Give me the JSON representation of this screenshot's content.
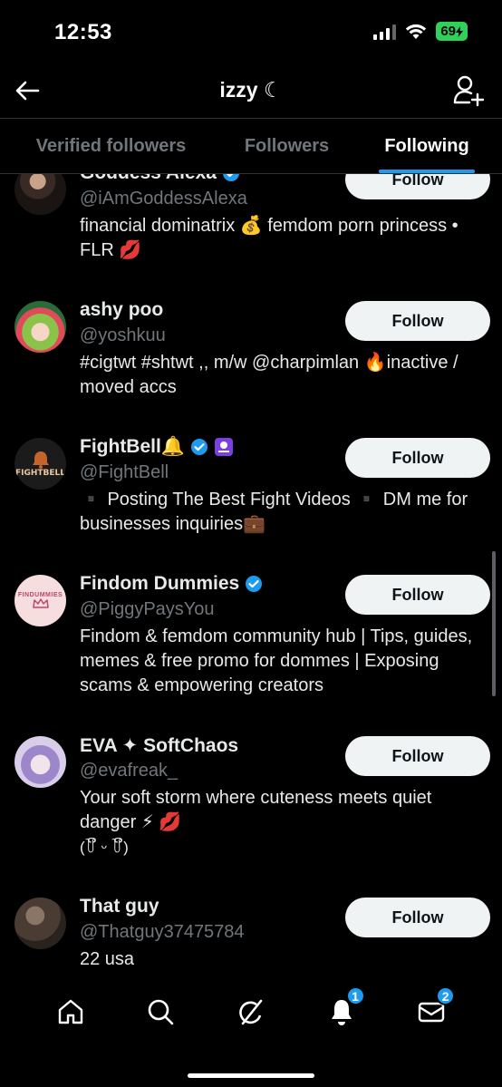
{
  "status": {
    "time": "12:53",
    "battery": "69"
  },
  "header": {
    "title": "izzy ☾"
  },
  "tabs": [
    {
      "label": "Verified followers"
    },
    {
      "label": "Followers"
    },
    {
      "label": "Following"
    }
  ],
  "users": [
    {
      "name": "Goddess Alexa",
      "handle": "@iAmGoddessAlexa",
      "bio": "financial dominatrix 💰 femdom porn princess • FLR 💋",
      "follow_label": "Follow"
    },
    {
      "name": "ashy poo",
      "handle": "@yoshkuu",
      "bio": "#cigtwt #shtwt ,, m/w @charpimlan 🔥inactive / moved accs",
      "follow_label": "Follow"
    },
    {
      "name": "FightBell🔔",
      "handle": "@FightBell",
      "bio": "▪️ Posting The Best Fight Videos ▪️  DM me for businesses inquiries💼",
      "follow_label": "Follow",
      "avatar_text": "FIGHTBELL"
    },
    {
      "name": "Findom Dummies",
      "handle": "@PiggyPaysYou",
      "bio": "Findom & femdom community hub | Tips, guides, memes & free promo for dommes | Exposing scams & empowering creators",
      "follow_label": "Follow",
      "avatar_text": "FINDUMMIES"
    },
    {
      "name": "EVA ✦ SoftChaos",
      "handle": "@evafreak_",
      "bio": "Your soft storm where cuteness meets quiet danger ⚡ 💋",
      "bio2": "(꒦ິ ᵕ ꒦ິ)",
      "follow_label": "Follow"
    },
    {
      "name": "That guy",
      "handle": "@Thatguy37475784",
      "bio": "22 usa",
      "follow_label": "Follow"
    }
  ],
  "nav": {
    "notifications_badge": "1",
    "messages_badge": "2"
  },
  "colors": {
    "accent": "#1d9bf0",
    "battery": "#30d158",
    "verified": "#1d9bf0"
  }
}
